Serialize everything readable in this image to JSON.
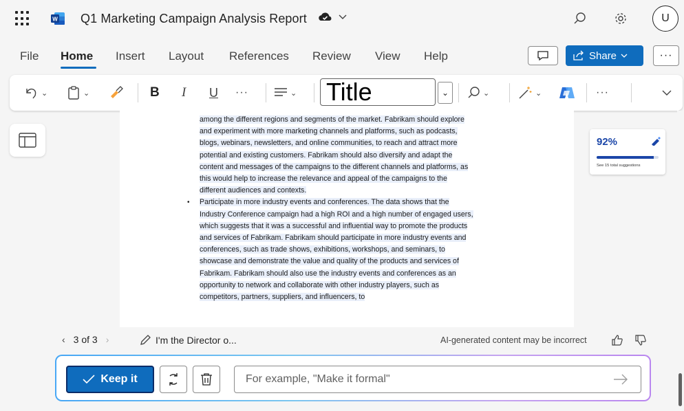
{
  "app": {
    "title": "Q1 Marketing Campaign Analysis Report",
    "avatar_initial": "U",
    "logo_letter": "W"
  },
  "tabs": [
    "File",
    "Home",
    "Insert",
    "Layout",
    "References",
    "Review",
    "View",
    "Help"
  ],
  "active_tab": "Home",
  "header_buttons": {
    "share_label": "Share"
  },
  "toolbar": {
    "bold": "B",
    "italic": "I",
    "underline": "U",
    "style_value": "Title"
  },
  "document": {
    "para1_lines": [
      "among the different regions and segments of the market. Fabrikam should explore",
      "and experiment with more marketing channels and platforms, such as podcasts,",
      "blogs, webinars, newsletters, and online communities, to reach and attract more",
      "potential and existing customers. Fabrikam should also diversify and adapt the",
      "content and messages of the campaigns to the different channels and platforms, as",
      "this would help to increase the relevance and appeal of the campaigns to the",
      "different audiences and contexts."
    ],
    "bullet_lines": [
      "Participate in more industry events and conferences. The data shows that the",
      "Industry Conference campaign had a high ROI and a high number of engaged users,",
      "which suggests that it was a successful and influential way to promote the products",
      "and services of Fabrikam. Fabrikam should participate in more industry events and",
      "conferences, such as trade shows, exhibitions, workshops, and seminars, to",
      "showcase and demonstrate the value and quality of the products and services of",
      "Fabrikam. Fabrikam should also use the industry events and conferences as an",
      "opportunity to network and collaborate with other industry players, such as",
      "competitors, partners, suppliers, and influencers, to"
    ]
  },
  "editor_score": {
    "value_label": "92%",
    "fraction": 0.92,
    "note": "See 15 total suggestions"
  },
  "copilot": {
    "pager": "3 of 3",
    "prompt_preview": "I'm the Director o...",
    "disclaimer": "AI-generated content may be incorrect",
    "keep_label": "Keep it",
    "input_placeholder": "For example, \"Make it formal\""
  },
  "colors": {
    "accent": "#0f6cbd",
    "highlight": "#e9effa",
    "score": "#1b46a8"
  }
}
